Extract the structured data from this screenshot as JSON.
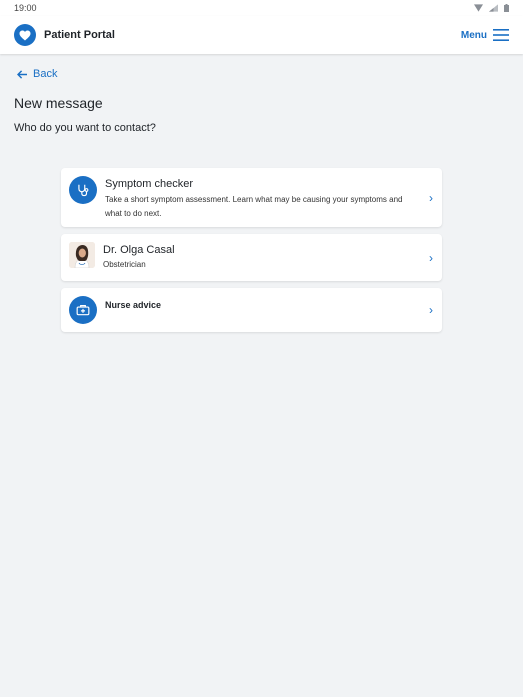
{
  "status_bar": {
    "time": "19:00"
  },
  "header": {
    "app_title": "Patient Portal",
    "menu_label": "Menu",
    "brand_color": "#1a6fc4"
  },
  "nav": {
    "back_label": "Back"
  },
  "page": {
    "title": "New message",
    "subtitle": "Who do you want to contact?"
  },
  "options": [
    {
      "title": "Symptom checker",
      "description": "Take a short symptom assessment. Learn what may be causing your symptoms and what to do next.",
      "icon": "stethoscope-icon"
    },
    {
      "title": "Dr. Olga Casal",
      "subtitle": "Obstetrician",
      "icon": "doctor-avatar"
    },
    {
      "title": "Nurse advice",
      "icon": "medical-kit-icon"
    }
  ]
}
